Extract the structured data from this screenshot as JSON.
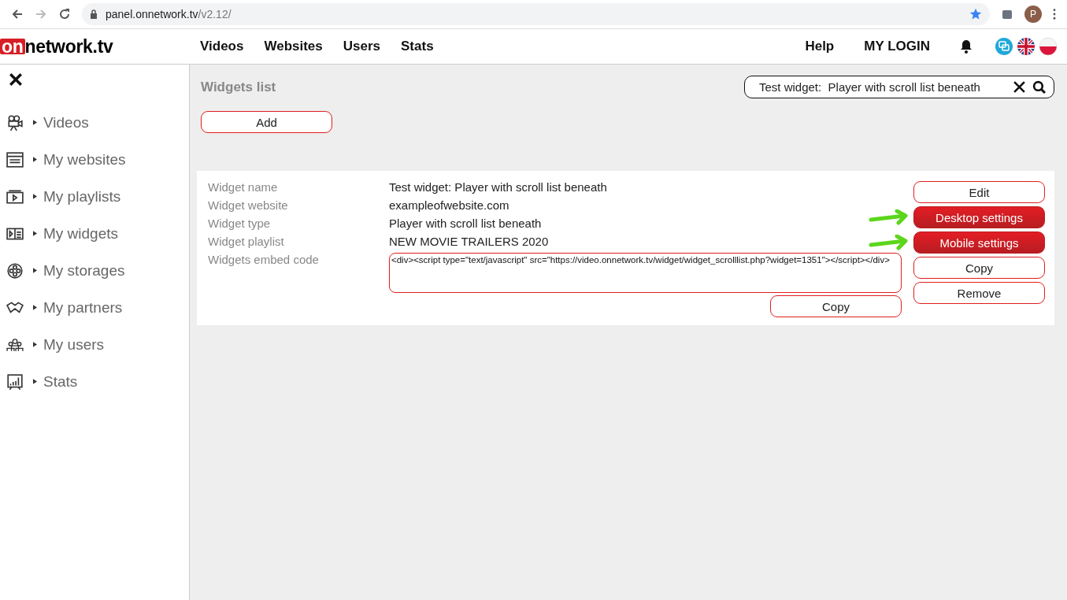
{
  "browser": {
    "url_host": "panel.onnetwork.tv",
    "url_path": "/v2.12/",
    "profile": "P"
  },
  "logo": {
    "boxed": "on",
    "rest": "network.tv"
  },
  "nav": [
    "Videos",
    "Websites",
    "Users",
    "Stats"
  ],
  "nav_right": [
    "Help",
    "MY LOGIN"
  ],
  "sidebar": {
    "items": [
      {
        "label": "Videos"
      },
      {
        "label": "My websites"
      },
      {
        "label": "My playlists"
      },
      {
        "label": "My widgets"
      },
      {
        "label": "My storages"
      },
      {
        "label": "My partners"
      },
      {
        "label": "My users"
      },
      {
        "label": "Stats"
      }
    ]
  },
  "page_title": "Widgets list",
  "search": {
    "value": "Test widget:  Player with scroll list beneath"
  },
  "add_button": "Add",
  "details": [
    {
      "label": "Widget name",
      "value": "Test widget: Player with scroll list beneath"
    },
    {
      "label": "Widget website",
      "value": "exampleofwebsite.com"
    },
    {
      "label": "Widget type",
      "value": "Player with scroll list beneath"
    },
    {
      "label": "Widget playlist",
      "value": "NEW MOVIE TRAILERS 2020"
    }
  ],
  "embed": {
    "label": "Widgets embed code",
    "value": "<div><script type=\"text/javascript\" src=\"https://video.onnetwork.tv/widget/widget_scrolllist.php?widget=1351\"></script></div>",
    "copy": "Copy"
  },
  "actions": [
    {
      "label": "Edit",
      "kind": "outline",
      "highlighted": false
    },
    {
      "label": "Desktop settings",
      "kind": "primary",
      "highlighted": true
    },
    {
      "label": "Mobile settings",
      "kind": "primary",
      "highlighted": true
    },
    {
      "label": "Copy",
      "kind": "outline",
      "highlighted": false
    },
    {
      "label": "Remove",
      "kind": "outline",
      "highlighted": false
    }
  ]
}
